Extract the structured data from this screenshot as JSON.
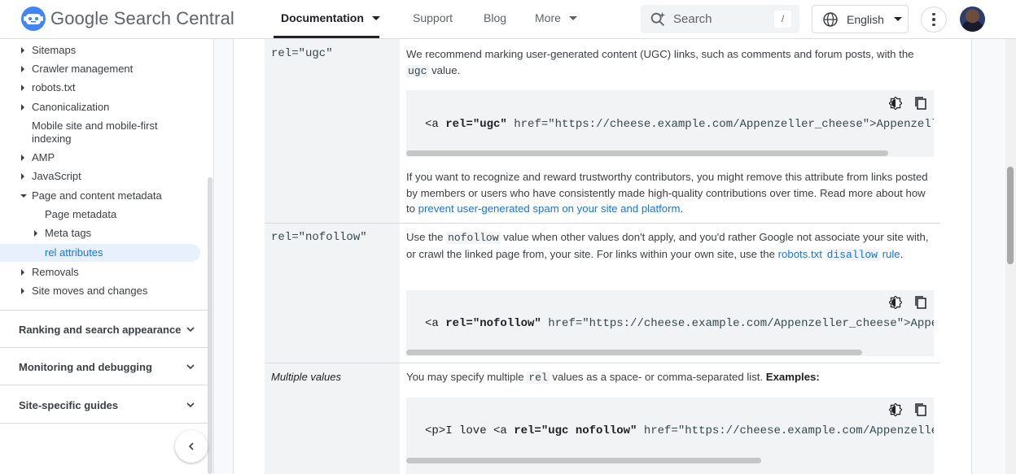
{
  "header": {
    "logo_text": "Google Search Central",
    "nav": [
      {
        "label": "Documentation"
      },
      {
        "label": "Support"
      },
      {
        "label": "Blog"
      },
      {
        "label": "More"
      }
    ],
    "search_placeholder": "Search",
    "search_shortcut": "/",
    "language": "English"
  },
  "sidebar": {
    "items": [
      {
        "label": "Sitemaps"
      },
      {
        "label": "Crawler management"
      },
      {
        "label": "robots.txt"
      },
      {
        "label": "Canonicalization"
      },
      {
        "label": "Mobile site and mobile-first"
      },
      {
        "label": "indexing"
      },
      {
        "label": "AMP"
      },
      {
        "label": "JavaScript"
      },
      {
        "label": "Page and content metadata"
      },
      {
        "label": "Page metadata"
      },
      {
        "label": "Meta tags"
      },
      {
        "label": "rel attributes"
      },
      {
        "label": "Removals"
      },
      {
        "label": "Site moves and changes"
      }
    ],
    "sections": [
      {
        "label": "Ranking and search appearance"
      },
      {
        "label": "Monitoring and debugging"
      },
      {
        "label": "Site-specific guides"
      }
    ]
  },
  "rows": [
    {
      "label": "rel=\"ugc\"",
      "p1_a": "We recommend marking user-generated content (UGC) links, such as comments and forum posts, with the ",
      "p1_code": "ugc",
      "p1_b": " value.",
      "code_pre": "<a ",
      "code_attr": "rel=\"ugc\"",
      "code_post": " href=\"https://cheese.example.com/Appenzeller_cheese\">Appenzeller</a>",
      "p2_a": "If you want to recognize and reward trustworthy contributors, you might remove this attribute from links posted by members or users who have consistently made high-quality contributions over time. Read more about how to ",
      "p2_link": "prevent user-generated spam on your site and platform",
      "p2_b": "."
    },
    {
      "label": "rel=\"nofollow\"",
      "p1_a": "Use the ",
      "p1_code": "nofollow",
      "p1_b": " value when other values don't apply, and you'd rather Google not associate your site with, or crawl the linked page from, your site. For links within your own site, use the ",
      "p1_link": "robots.txt",
      "p1_link_code": "disallow",
      "p1_link_end": " rule",
      "p1_c": ".",
      "code_pre": "<a ",
      "code_attr": "rel=\"nofollow\"",
      "code_post": " href=\"https://cheese.example.com/Appenzeller_cheese\">Appenzeller</a>"
    },
    {
      "label": "Multiple values",
      "p1_a": "You may specify multiple ",
      "p1_code": "rel",
      "p1_b": " values as a space- or comma-separated list. ",
      "p1_bold": "Examples:",
      "code_pre": "<p>I love <a ",
      "code_attr": "rel=\"ugc nofollow\"",
      "code_post": " href=\"https://cheese.example.com/Appenzeller_cheese\">Appenzeller</a>"
    }
  ]
}
